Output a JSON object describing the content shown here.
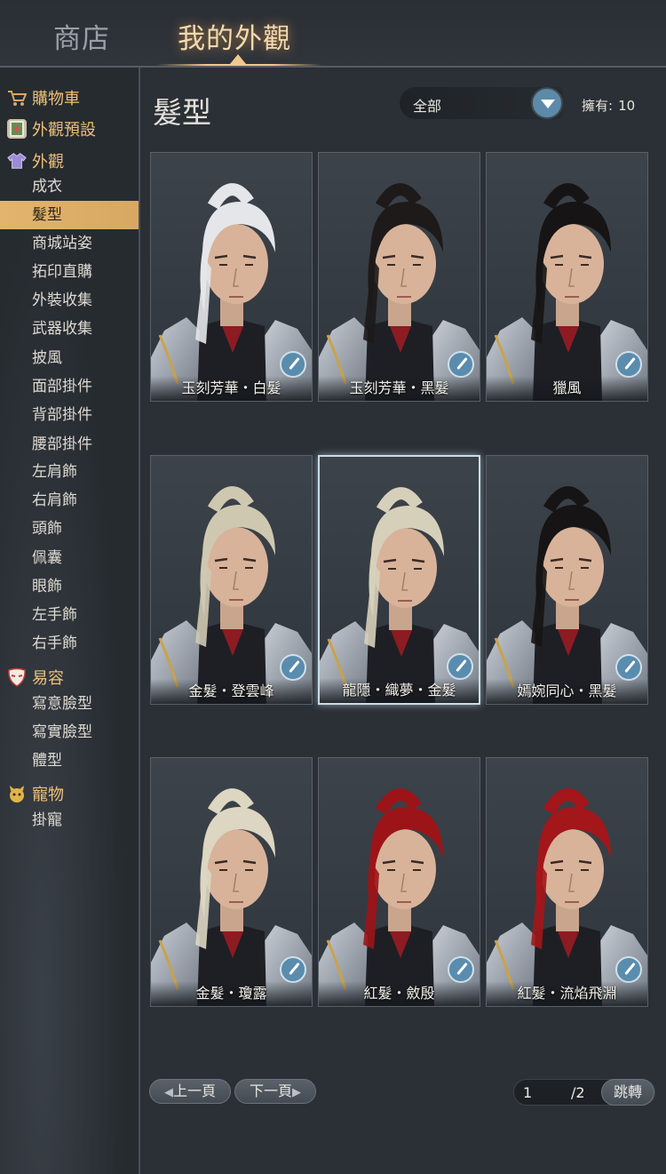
{
  "tabs": {
    "shop": "商店",
    "mine": "我的外觀"
  },
  "sidebar": {
    "categories": [
      {
        "label": "購物車",
        "icon": "cart-icon"
      },
      {
        "label": "外觀預設",
        "icon": "preset-icon"
      },
      {
        "label": "外觀",
        "icon": "outfit-icon"
      },
      {
        "label": "易容",
        "icon": "mask-icon"
      },
      {
        "label": "寵物",
        "icon": "pet-icon"
      }
    ],
    "appearance_items": [
      "成衣",
      "髮型",
      "商城站姿",
      "拓印直購",
      "外裝收集",
      "武器收集",
      "披風",
      "面部掛件",
      "背部掛件",
      "腰部掛件",
      "左肩飾",
      "右肩飾",
      "頭飾",
      "佩囊",
      "眼飾",
      "左手飾",
      "右手飾"
    ],
    "disguise_items": [
      "寫意臉型",
      "寫實臉型",
      "體型"
    ],
    "pet_items": [
      "掛寵"
    ],
    "active_item": "髮型"
  },
  "main": {
    "title": "髮型",
    "filter_value": "全部",
    "owned_label": "擁有:",
    "owned_count": "10"
  },
  "hairstyles": [
    {
      "name": "玉刻芳華・白髮",
      "hair_color": "#e4e6ea"
    },
    {
      "name": "玉刻芳華・黑髮",
      "hair_color": "#1d1a19"
    },
    {
      "name": "獵風",
      "hair_color": "#161414"
    },
    {
      "name": "金髮・登雲峰",
      "hair_color": "#cfc8b1"
    },
    {
      "name": "龍隱・織夢・金髮",
      "hair_color": "#d6d0ba"
    },
    {
      "name": "嫣婉同心・黑髮",
      "hair_color": "#161414"
    },
    {
      "name": "金髮・瓊露",
      "hair_color": "#dcd6c2"
    },
    {
      "name": "紅髮・斂殷",
      "hair_color": "#9c1418"
    },
    {
      "name": "紅髮・流焰飛淵",
      "hair_color": "#a3161a"
    }
  ],
  "selected_card": "龍隱・織夢・金髮",
  "pagination": {
    "prev_label": "上一頁",
    "next_label": "下一頁",
    "current_page": "1",
    "total_pages": "/2",
    "jump_label": "跳轉"
  },
  "colors": {
    "accent_gold": "#f3c889",
    "active_bg": "#e3b46d",
    "brush_blue": "#5a8cae"
  }
}
